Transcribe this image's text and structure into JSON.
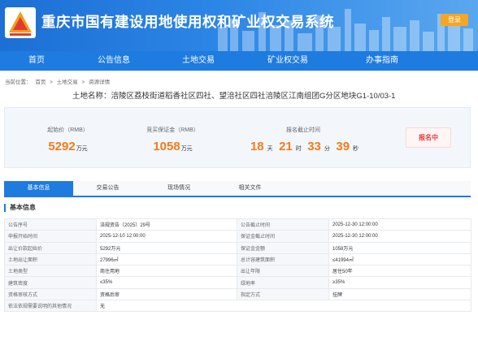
{
  "header": {
    "site_title": "重庆市国有建设用地使用权和矿业权交易系统",
    "login_label": "登录"
  },
  "nav": {
    "items": [
      {
        "label": "首页"
      },
      {
        "label": "公告信息"
      },
      {
        "label": "土地交易"
      },
      {
        "label": "矿业权交易"
      },
      {
        "label": "办事指南"
      }
    ]
  },
  "breadcrumb": {
    "prefix": "当前位置：",
    "items": [
      "首页",
      ">",
      "土地交易",
      ">",
      "资源详情"
    ]
  },
  "land": {
    "title_label": "土地名称：",
    "title_value": "涪陵区荔枝街道稻香社区四社、望涪社区四社涪陵区江南组团G分区地块G1-10/03-1"
  },
  "summary": {
    "start_price_label": "起始价（RMB）",
    "start_price_value": "5292",
    "start_price_unit": "万元",
    "deposit_label": "竞买保证金（RMB）",
    "deposit_value": "1058",
    "deposit_unit": "万元",
    "deadline_label": "报名截止时间",
    "countdown": {
      "days": "18",
      "days_unit": "天",
      "hours": "21",
      "hours_unit": "时",
      "minutes": "33",
      "minutes_unit": "分",
      "seconds": "39",
      "seconds_unit": "秒"
    },
    "status": "报名中"
  },
  "tabs": [
    {
      "label": "基本信息",
      "active": true
    },
    {
      "label": "交易公告",
      "active": false
    },
    {
      "label": "现场情况",
      "active": false
    },
    {
      "label": "相关文件",
      "active": false
    }
  ],
  "basic_info": {
    "section_title": "基本信息",
    "rows": [
      {
        "l1": "公告序号",
        "v1": "涪规资告〔2025〕29号",
        "l2": "公告截止时间",
        "v2": "2025-12-30 12:00:00"
      },
      {
        "l1": "申报开始时间",
        "v1": "2025-12-10 12:00:00",
        "l2": "保证金截止时间",
        "v2": "2025-12-30 12:00:00"
      },
      {
        "l1": "出让价款起始价",
        "v1": "5292万元",
        "l2": "保证金金额",
        "v2": "1058万元"
      },
      {
        "l1": "土地出让面积",
        "v1": "27996㎡",
        "l2": "总计容建筑面积",
        "v2": "≤41994㎡"
      },
      {
        "l1": "土地类型",
        "v1": "商住用地",
        "l2": "出让年限",
        "v2": "居住50年"
      },
      {
        "l1": "建筑密度",
        "v1": "≤35%",
        "l2": "绿地率",
        "v2": "≥35%"
      },
      {
        "l1": "资格审核方式",
        "v1": "资格后审",
        "l2": "指定方式",
        "v2": "挂牌"
      },
      {
        "l1": "依法依规需要说明的其他情况",
        "v1": "无"
      }
    ]
  },
  "colors": {
    "primary": "#1e7be0",
    "accent_orange": "#f27b18",
    "status_red": "#e53935",
    "login_orange": "#f5a623"
  }
}
